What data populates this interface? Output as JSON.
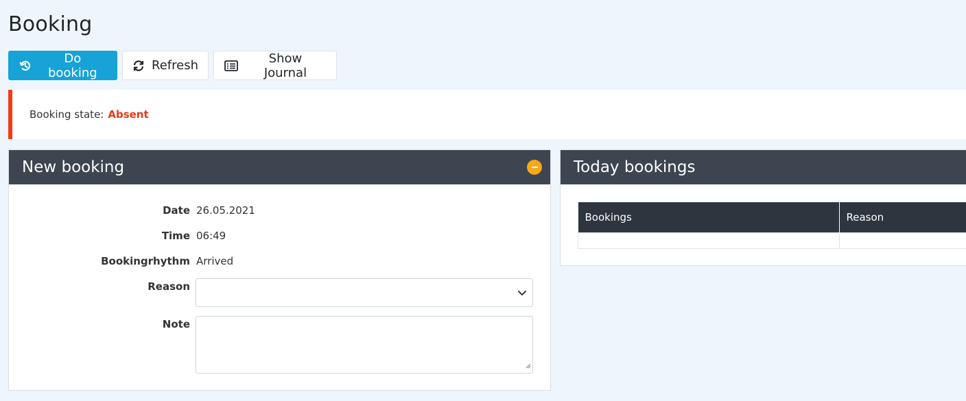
{
  "page": {
    "title": "Booking"
  },
  "toolbar": {
    "do_booking_label": "Do booking",
    "refresh_label": "Refresh",
    "show_journal_label": "Show Journal"
  },
  "status": {
    "label": "Booking state:",
    "value": "Absent",
    "color": "#e8391a"
  },
  "new_booking": {
    "title": "New booking",
    "fields": {
      "date": {
        "label": "Date",
        "value": "26.05.2021"
      },
      "time": {
        "label": "Time",
        "value": "06:49"
      },
      "rhythm": {
        "label": "Bookingrhythm",
        "value": "Arrived"
      },
      "reason": {
        "label": "Reason",
        "value": ""
      },
      "note": {
        "label": "Note",
        "value": ""
      }
    }
  },
  "today_bookings": {
    "title": "Today bookings",
    "columns": [
      "Bookings",
      "Reason"
    ],
    "rows": [
      [
        "",
        ""
      ]
    ]
  },
  "colors": {
    "primary": "#17a2d8",
    "header_dark": "#3d4550",
    "alert_border": "#f23c16",
    "collapse": "#f7a718"
  }
}
